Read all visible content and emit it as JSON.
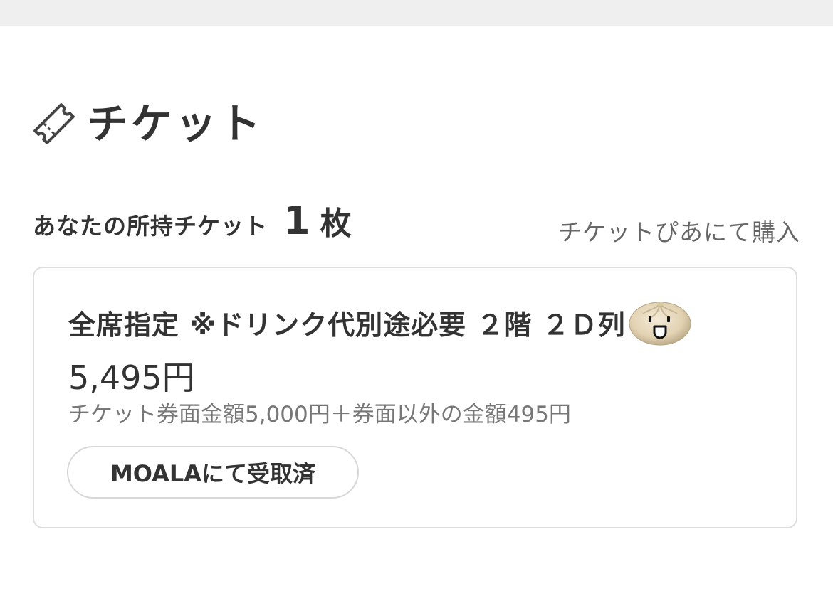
{
  "section": {
    "title": "チケット",
    "icon": "ticket-icon"
  },
  "owned": {
    "label": "あなたの所持チケット",
    "count": "1",
    "unit": "枚"
  },
  "buy_link": {
    "label": "チケットぴあにて購入"
  },
  "ticket": {
    "seat": "全席指定 ※ドリンク代別途必要 ２階 ２Ｄ列",
    "emoji": "steamed-bun-face-icon",
    "price": "5,495円",
    "price_detail": "チケット券面金額5,000円＋券面以外の金額495円",
    "status_button": "MOALAにて受取済"
  },
  "colors": {
    "top_bar": "#efefef",
    "text": "#333333",
    "muted_text": "#777777",
    "border": "#dedede"
  }
}
